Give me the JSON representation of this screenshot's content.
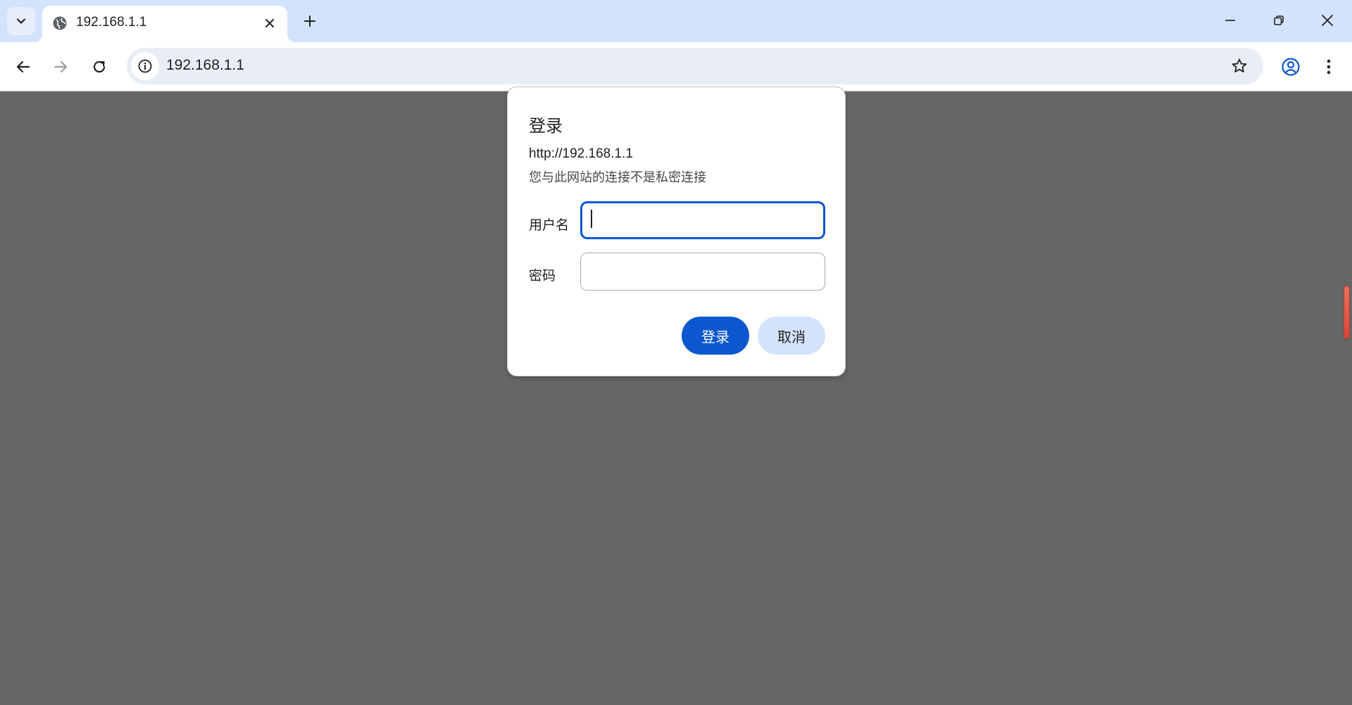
{
  "browser": {
    "tab": {
      "title": "192.168.1.1",
      "favicon": "globe-icon"
    },
    "address_bar": {
      "url": "192.168.1.1"
    },
    "accent_color": "#0b57d0",
    "tabstrip_color": "#d3e3fd"
  },
  "dialog": {
    "title": "登录",
    "origin": "http://192.168.1.1",
    "warning": "您与此网站的连接不是私密连接",
    "username_label": "用户名",
    "username_value": "",
    "password_label": "密码",
    "password_value": "",
    "login_button": "登录",
    "cancel_button": "取消"
  }
}
